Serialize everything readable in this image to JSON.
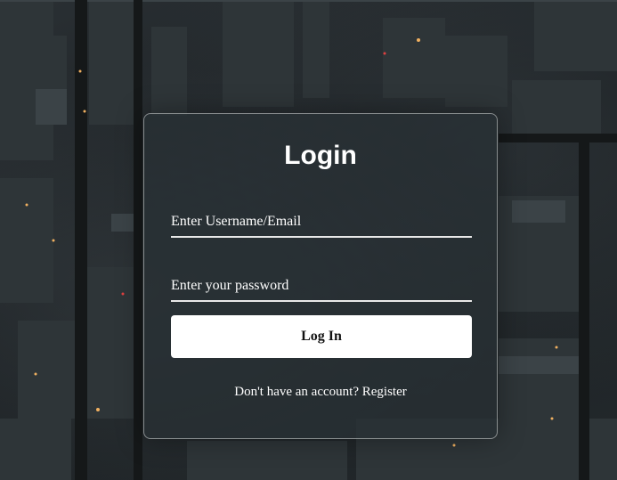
{
  "login": {
    "title": "Login",
    "username_placeholder": "Enter Username/Email",
    "password_placeholder": "Enter your password",
    "submit_label": "Log In",
    "register_prompt": "Don't have an account?",
    "register_link": "Register"
  },
  "colors": {
    "card_border": "#d8d8d8",
    "button_background": "#ffffff",
    "text": "#ffffff"
  }
}
